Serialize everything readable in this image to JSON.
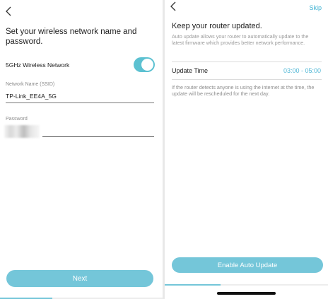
{
  "left_screen": {
    "heading": "Set your wireless network name and password.",
    "toggle": {
      "label": "5GHz Wireless Network",
      "checked": true
    },
    "ssid": {
      "label": "Network Name (SSID)",
      "value": "TP-Link_EE4A_5G"
    },
    "password": {
      "label": "Password",
      "value": ""
    },
    "next_label": "Next",
    "progress": 0.32
  },
  "right_screen": {
    "skip_label": "Skip",
    "heading": "Keep your router updated.",
    "description": "Auto update allows your router to automatically update to the latest firmware which provides better network performance.",
    "update_time": {
      "label": "Update Time",
      "value": "03:00 - 05:00"
    },
    "note": "If the router detects anyone is using the internet at the time, the update will be rescheduled for the next day.",
    "enable_label": "Enable Auto Update",
    "progress": 0.34
  },
  "colors": {
    "accent": "#74c6d9",
    "link": "#3fb2d2",
    "toggle_on": "#5cc1d1"
  },
  "icons": {
    "back": "chevron-left-icon"
  }
}
